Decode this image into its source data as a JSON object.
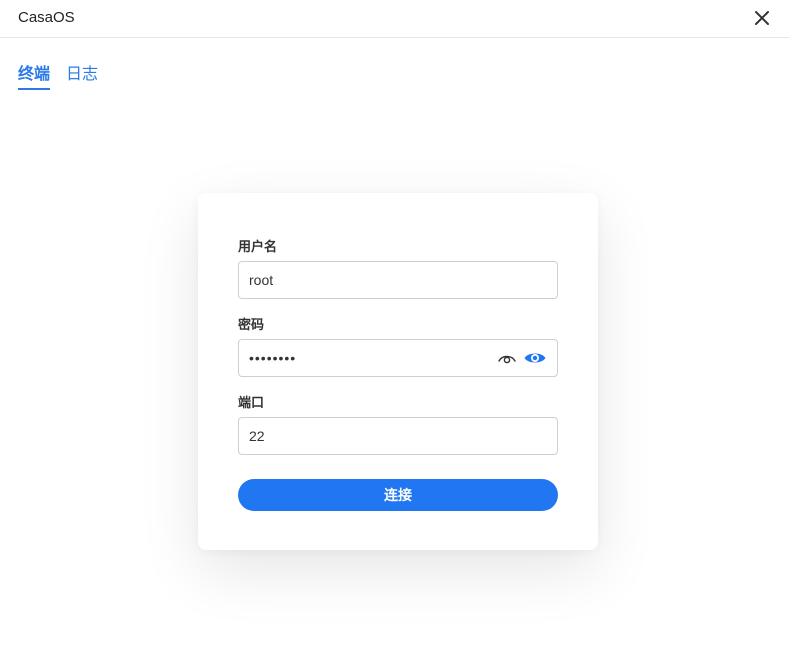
{
  "window": {
    "title": "CasaOS"
  },
  "tabs": [
    {
      "label": "终端",
      "active": true
    },
    {
      "label": "日志",
      "active": false
    }
  ],
  "form": {
    "username": {
      "label": "用户名",
      "value": "root"
    },
    "password": {
      "label": "密码",
      "value": "••••••••"
    },
    "port": {
      "label": "端口",
      "value": "22"
    },
    "connect_label": "连接"
  },
  "icons": {
    "close": "close-icon",
    "eye_outline": "eye-outline-icon",
    "eye_filled": "eye-icon"
  },
  "colors": {
    "accent": "#2b7ae6",
    "button": "#2177f2",
    "border": "#cfcfcf"
  }
}
